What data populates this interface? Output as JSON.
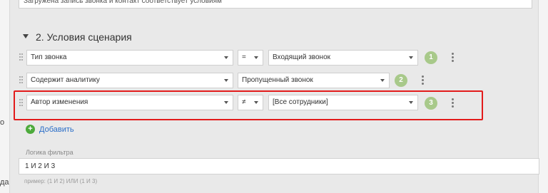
{
  "top_box_text": "Загружена запись звонка и контакт соответствует условиям",
  "section_title": "2. Условия сценария",
  "conditions": [
    {
      "field": "Тип звонка",
      "operator": "=",
      "value": "Входящий звонок",
      "number": "1"
    },
    {
      "field": "Содержит аналитику",
      "operator": "",
      "value": "Пропущенный звонок",
      "number": "2"
    },
    {
      "field": "Автор изменения",
      "operator": "≠",
      "value": "[Все сотрудники]",
      "number": "3"
    }
  ],
  "add_label": "Добавить",
  "logic": {
    "label": "Логика фильтра",
    "value": "1 И 2 И 3",
    "example": "пример: (1 И 2) ИЛИ (1 И 3)"
  },
  "left_fragments": [
    "о",
    "да"
  ],
  "accent_colors": {
    "highlight": "#e21b1b",
    "badge": "#a8c98a",
    "add": "#4caa3b",
    "link": "#2a6ec8"
  }
}
